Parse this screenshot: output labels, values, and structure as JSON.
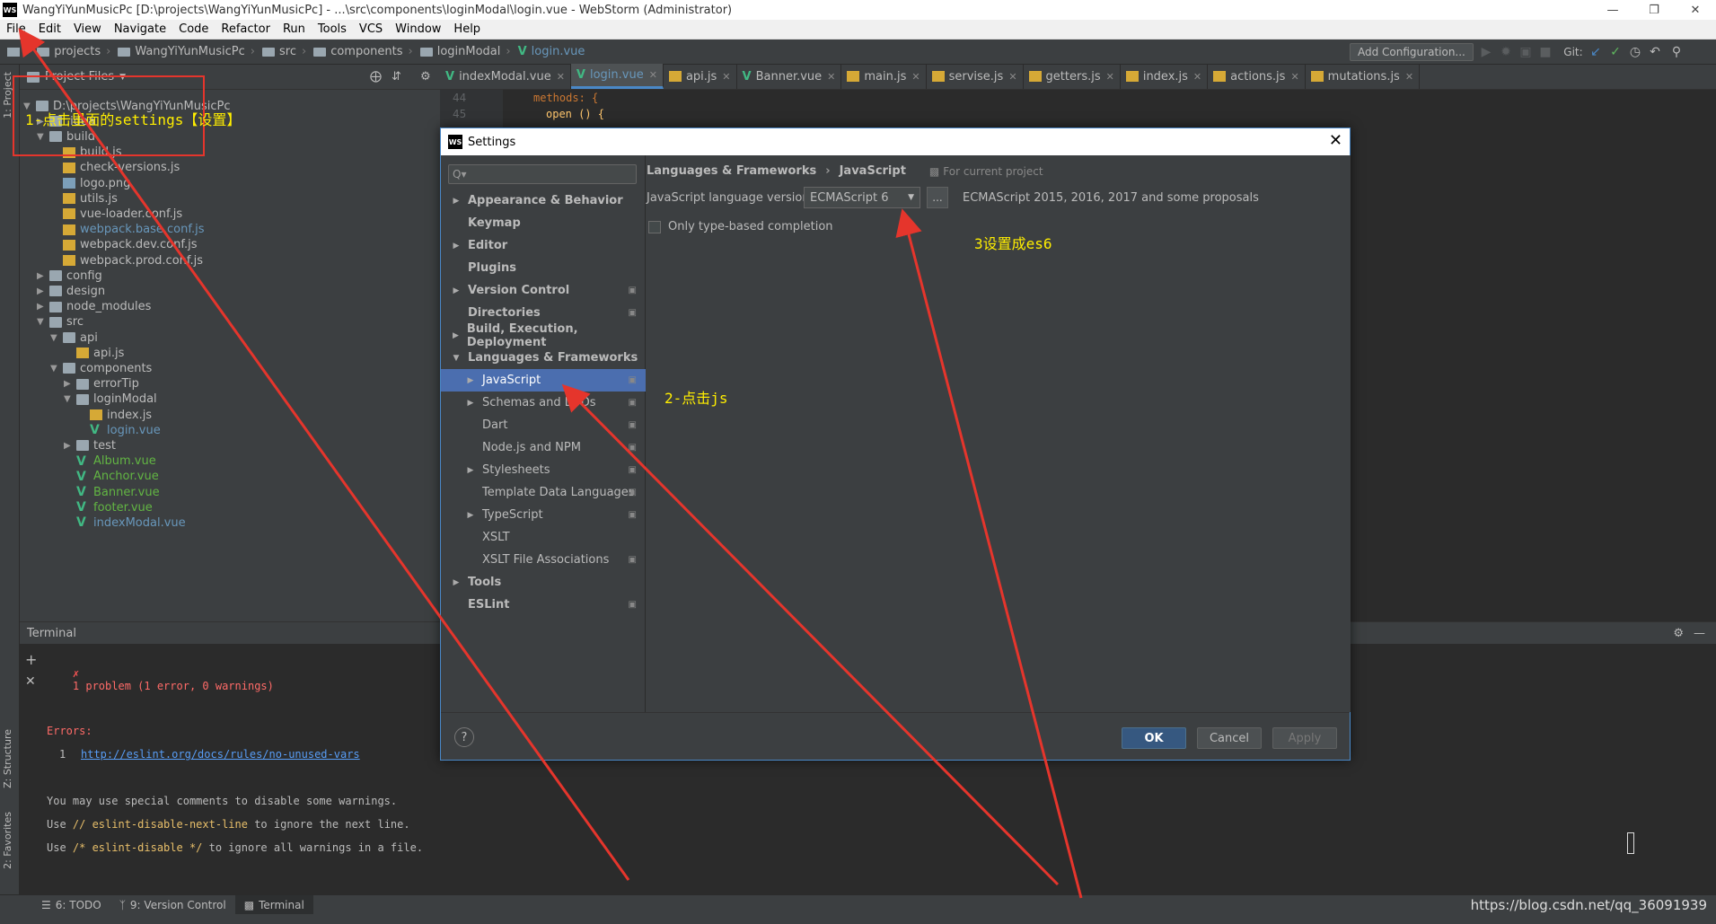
{
  "window": {
    "title": "WangYiYunMusicPc [D:\\projects\\WangYiYunMusicPc] - ...\\src\\components\\loginModal\\login.vue - WebStorm (Administrator)",
    "app_logo": "WS"
  },
  "menu": [
    "File",
    "Edit",
    "View",
    "Navigate",
    "Code",
    "Refactor",
    "Run",
    "Tools",
    "VCS",
    "Window",
    "Help"
  ],
  "breadcrumbs": [
    "projects",
    "WangYiYunMusicPc",
    "src",
    "components",
    "loginModal",
    "login.vue"
  ],
  "toolbar": {
    "add_config": "Add Configuration...",
    "git_label": "Git:"
  },
  "side_tabs": {
    "project": "1: Project",
    "structure": "Z: Structure",
    "favorites": "2: Favorites"
  },
  "project": {
    "header": "Project Files",
    "items": [
      {
        "label": "D:\\projects\\WangYiYunMusicPc",
        "type": "folder"
      },
      {
        "label": ".idea",
        "type": "folder"
      },
      {
        "label": "build",
        "type": "folder"
      },
      {
        "label": "build.js",
        "type": "js"
      },
      {
        "label": "check-versions.js",
        "type": "js"
      },
      {
        "label": "logo.png",
        "type": "img"
      },
      {
        "label": "utils.js",
        "type": "js"
      },
      {
        "label": "vue-loader.conf.js",
        "type": "js"
      },
      {
        "label": "webpack.base.conf.js",
        "type": "js"
      },
      {
        "label": "webpack.dev.conf.js",
        "type": "js"
      },
      {
        "label": "webpack.prod.conf.js",
        "type": "js"
      },
      {
        "label": "config",
        "type": "folder"
      },
      {
        "label": "design",
        "type": "folder"
      },
      {
        "label": "node_modules",
        "type": "folder"
      },
      {
        "label": "src",
        "type": "folder"
      },
      {
        "label": "api",
        "type": "folder"
      },
      {
        "label": "api.js",
        "type": "js"
      },
      {
        "label": "components",
        "type": "folder"
      },
      {
        "label": "errorTip",
        "type": "folder"
      },
      {
        "label": "loginModal",
        "type": "folder"
      },
      {
        "label": "index.js",
        "type": "js"
      },
      {
        "label": "login.vue",
        "type": "vue"
      },
      {
        "label": "test",
        "type": "folder"
      },
      {
        "label": "Album.vue",
        "type": "vue"
      },
      {
        "label": "Anchor.vue",
        "type": "vue"
      },
      {
        "label": "Banner.vue",
        "type": "vue"
      },
      {
        "label": "footer.vue",
        "type": "vue"
      },
      {
        "label": "indexModal.vue",
        "type": "vue"
      }
    ]
  },
  "editor": {
    "tabs": [
      "indexModal.vue",
      "login.vue",
      "api.js",
      "Banner.vue",
      "main.js",
      "servise.js",
      "getters.js",
      "index.js",
      "actions.js",
      "mutations.js"
    ],
    "line_numbers": [
      "44",
      "45"
    ],
    "code_lines": [
      "methods: {",
      "open () {"
    ]
  },
  "terminal": {
    "title": "Terminal",
    "problem": "1 problem (1 error, 0 warnings)",
    "errors_label": "Errors:",
    "error_count": "1",
    "error_link": "http://eslint.org/docs/rules/no-unused-vars",
    "tip1": "You may use special comments to disable some warnings.",
    "tip2_pre": "Use ",
    "tip2_code": "// eslint-disable-next-line",
    "tip2_post": " to ignore the next line.",
    "tip3_pre": "Use ",
    "tip3_code": "/* eslint-disable */",
    "tip3_post": " to ignore all warnings in a file."
  },
  "bottom_tabs": [
    "6: TODO",
    "9: Version Control",
    "Terminal"
  ],
  "watermark": "https://blog.csdn.net/qq_36091939",
  "dialog": {
    "title": "Settings",
    "search_placeholder": "Q▾",
    "tree": [
      {
        "label": "Appearance & Behavior",
        "bold": true,
        "arrow": "right",
        "level": 0
      },
      {
        "label": "Keymap",
        "bold": true,
        "arrow": "",
        "level": 0
      },
      {
        "label": "Editor",
        "bold": true,
        "arrow": "right",
        "level": 0
      },
      {
        "label": "Plugins",
        "bold": true,
        "arrow": "",
        "level": 0
      },
      {
        "label": "Version Control",
        "bold": true,
        "arrow": "right",
        "level": 0,
        "proj": true
      },
      {
        "label": "Directories",
        "bold": true,
        "arrow": "",
        "level": 0,
        "proj": true
      },
      {
        "label": "Build, Execution, Deployment",
        "bold": true,
        "arrow": "right",
        "level": 0
      },
      {
        "label": "Languages & Frameworks",
        "bold": true,
        "arrow": "down",
        "level": 0
      },
      {
        "label": "JavaScript",
        "bold": false,
        "arrow": "right",
        "level": 1,
        "proj": true,
        "selected": true
      },
      {
        "label": "Schemas and DTDs",
        "bold": false,
        "arrow": "right",
        "level": 1,
        "proj": true
      },
      {
        "label": "Dart",
        "bold": false,
        "arrow": "",
        "level": 1,
        "proj": true
      },
      {
        "label": "Node.js and NPM",
        "bold": false,
        "arrow": "",
        "level": 1,
        "proj": true
      },
      {
        "label": "Stylesheets",
        "bold": false,
        "arrow": "right",
        "level": 1,
        "proj": true
      },
      {
        "label": "Template Data Languages",
        "bold": false,
        "arrow": "",
        "level": 1,
        "proj": true
      },
      {
        "label": "TypeScript",
        "bold": false,
        "arrow": "right",
        "level": 1,
        "proj": true
      },
      {
        "label": "XSLT",
        "bold": false,
        "arrow": "",
        "level": 1
      },
      {
        "label": "XSLT File Associations",
        "bold": false,
        "arrow": "",
        "level": 1,
        "proj": true
      },
      {
        "label": "Tools",
        "bold": true,
        "arrow": "right",
        "level": 0
      },
      {
        "label": "ESLint",
        "bold": true,
        "arrow": "",
        "level": 0,
        "proj": true
      }
    ],
    "crumb_parent": "Languages & Frameworks",
    "crumb_current": "JavaScript",
    "for_project": "For current project",
    "lang_version_label": "JavaScript language version",
    "lang_version_value": "ECMAScript 6",
    "more_btn": "...",
    "lang_desc": "ECMAScript 2015, 2016, 2017 and some proposals",
    "only_type_based": "Only type-based completion",
    "help": "?",
    "ok": "OK",
    "cancel": "Cancel",
    "apply": "Apply"
  },
  "annotations": {
    "step1": "1-点击里面的settings【设置】",
    "step2": "2-点击js",
    "step3": "3设置成es6"
  },
  "colors": {
    "accent": "#4b6eaf",
    "annotation_arrow": "#e5352c",
    "annotation_text": "#ffee00",
    "vue": "#41b883"
  }
}
